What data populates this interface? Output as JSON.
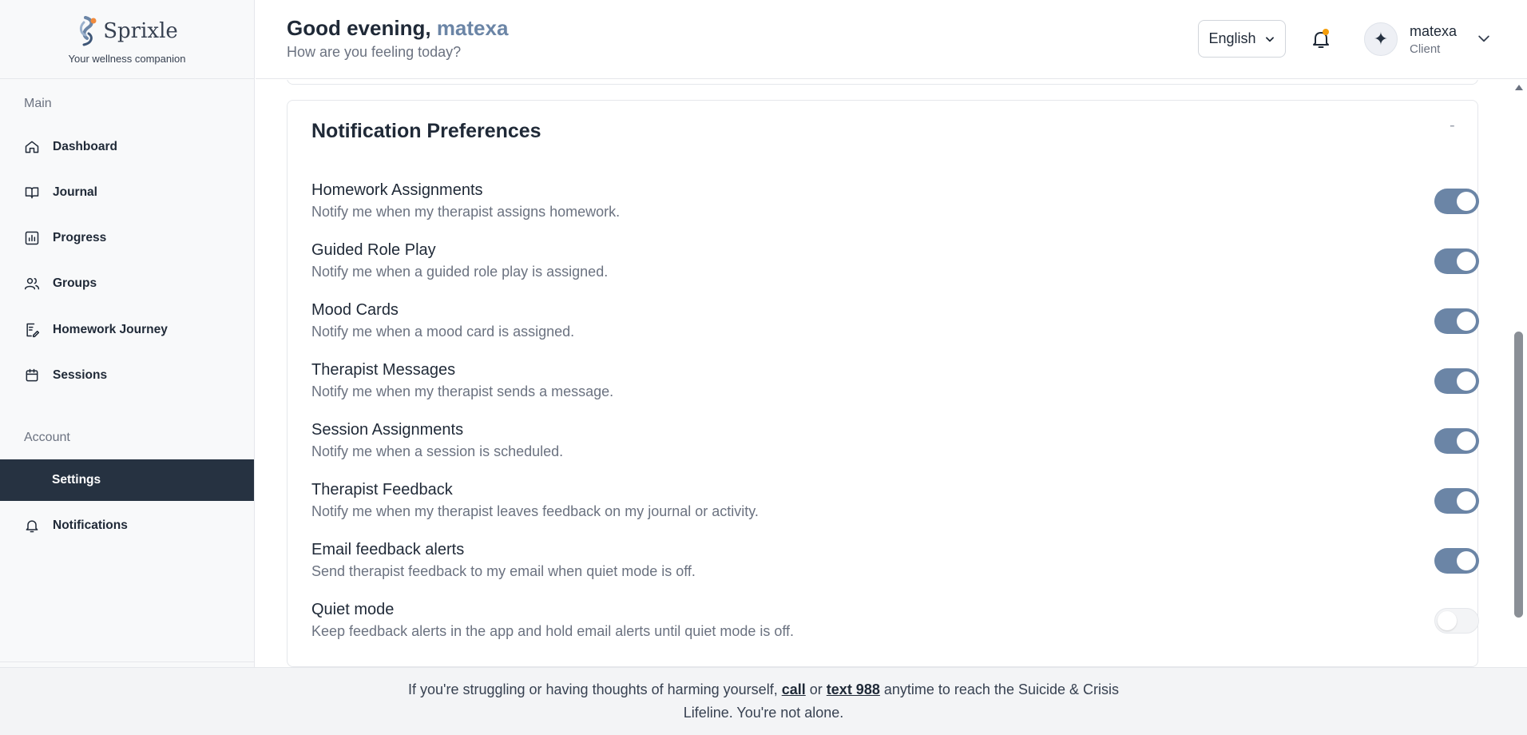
{
  "brand": {
    "name": "Sprixle",
    "tagline": "Your wellness companion"
  },
  "sidebar": {
    "main_label": "Main",
    "items": [
      {
        "label": "Dashboard",
        "icon": "home-icon"
      },
      {
        "label": "Journal",
        "icon": "book-icon"
      },
      {
        "label": "Progress",
        "icon": "chart-icon"
      },
      {
        "label": "Groups",
        "icon": "users-icon"
      },
      {
        "label": "Homework Journey",
        "icon": "notepad-icon"
      },
      {
        "label": "Sessions",
        "icon": "calendar-icon"
      }
    ],
    "account_label": "Account",
    "account_items": [
      {
        "label": "Settings",
        "active": true
      },
      {
        "label": "Notifications",
        "icon": "bell-icon"
      }
    ]
  },
  "header": {
    "greeting_prefix": "Good evening,",
    "username": "matexa",
    "subtitle": "How are you feeling today?",
    "language": "English",
    "user_name": "matexa",
    "user_role": "Client"
  },
  "notifications": {
    "title": "Notification Preferences",
    "collapse_symbol": "-",
    "prefs": [
      {
        "title": "Homework Assignments",
        "desc": "Notify me when my therapist assigns homework.",
        "enabled": true
      },
      {
        "title": "Guided Role Play",
        "desc": "Notify me when a guided role play is assigned.",
        "enabled": true
      },
      {
        "title": "Mood Cards",
        "desc": "Notify me when a mood card is assigned.",
        "enabled": true
      },
      {
        "title": "Therapist Messages",
        "desc": "Notify me when my therapist sends a message.",
        "enabled": true
      },
      {
        "title": "Session Assignments",
        "desc": "Notify me when a session is scheduled.",
        "enabled": true
      },
      {
        "title": "Therapist Feedback",
        "desc": "Notify me when my therapist leaves feedback on my journal or activity.",
        "enabled": true
      },
      {
        "title": "Email feedback alerts",
        "desc": "Send therapist feedback to my email when quiet mode is off.",
        "enabled": true
      },
      {
        "title": "Quiet mode",
        "desc": "Keep feedback alerts in the app and hold email alerts until quiet mode is off.",
        "enabled": false
      }
    ]
  },
  "crisis": {
    "part1": "If you're struggling or having thoughts of harming yourself,",
    "call": "call",
    "or": "or",
    "text988": "text 988",
    "part2": "anytime to reach the Suicide & Crisis Lifeline. You're not alone."
  },
  "colors": {
    "accent": "#6b85a6",
    "active_nav": "#263241",
    "notification_dot": "#f59e0b"
  }
}
